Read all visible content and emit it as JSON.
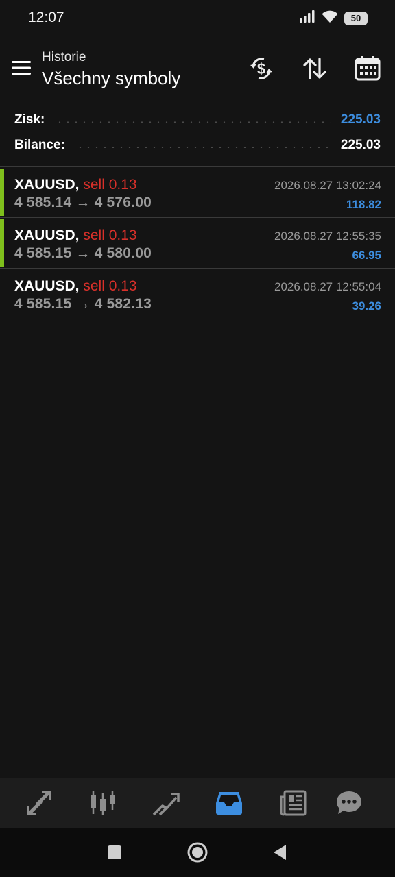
{
  "status_bar": {
    "time": "12:07",
    "battery": "50"
  },
  "header": {
    "subtitle": "Historie",
    "title": "Všechny symboly",
    "icons": [
      "menu-icon",
      "currency-exchange-icon",
      "sort-icon",
      "calendar-icon"
    ]
  },
  "summary": {
    "profit_label": "Zisk:",
    "profit_value": "225.03",
    "balance_label": "Bilance:",
    "balance_value": "225.03"
  },
  "trades": [
    {
      "symbol": "XAUUSD,",
      "side": "sell 0.13",
      "prices": "4 585.14 → 4 576.00",
      "date": "2026.08.27 13:02:24",
      "profit": "118.82",
      "marked": true
    },
    {
      "symbol": "XAUUSD,",
      "side": "sell 0.13",
      "prices": "4 585.15 → 4 580.00",
      "date": "2026.08.27 12:55:35",
      "profit": "66.95",
      "marked": true
    },
    {
      "symbol": "XAUUSD,",
      "side": "sell 0.13",
      "prices": "4 585.15 → 4 582.13",
      "date": "2026.08.27 12:55:04",
      "profit": "39.26",
      "marked": false
    }
  ],
  "tabs": [
    "quotes-icon",
    "chart-icon",
    "trade-icon",
    "history-icon",
    "news-icon",
    "messages-icon"
  ],
  "active_tab": "history-icon",
  "colors": {
    "background": "#141414",
    "accent_blue": "#3d8ee0",
    "sell_red": "#d8302a",
    "marker_green": "#7fbf1c",
    "muted": "#9a9a9a"
  }
}
